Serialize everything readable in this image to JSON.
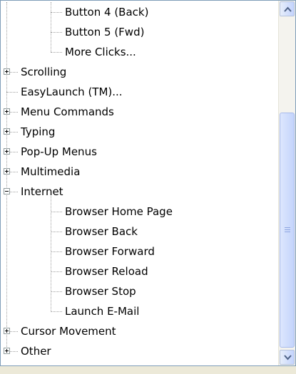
{
  "tree": {
    "items": [
      {
        "label": "Button 4 (Back)"
      },
      {
        "label": "Button 5 (Fwd)"
      },
      {
        "label": "More Clicks..."
      },
      {
        "label": "Scrolling"
      },
      {
        "label": "EasyLaunch (TM)..."
      },
      {
        "label": "Menu Commands"
      },
      {
        "label": "Typing"
      },
      {
        "label": "Pop-Up Menus"
      },
      {
        "label": "Multimedia"
      },
      {
        "label": "Internet"
      },
      {
        "label": "Browser Home Page"
      },
      {
        "label": "Browser Back"
      },
      {
        "label": "Browser Forward"
      },
      {
        "label": "Browser Reload"
      },
      {
        "label": "Browser Stop"
      },
      {
        "label": "Launch E-Mail"
      },
      {
        "label": "Cursor Movement"
      },
      {
        "label": "Other"
      }
    ]
  },
  "scrollbar": {
    "up_icon": "scroll-up-arrow",
    "down_icon": "scroll-down-arrow",
    "thumb_grip_icon": "grip-lines"
  },
  "colors": {
    "border": "#7f9db9",
    "tree_line": "#a0a0a0",
    "scroll_button": "#c3d3fd",
    "background": "#ece9d8"
  }
}
